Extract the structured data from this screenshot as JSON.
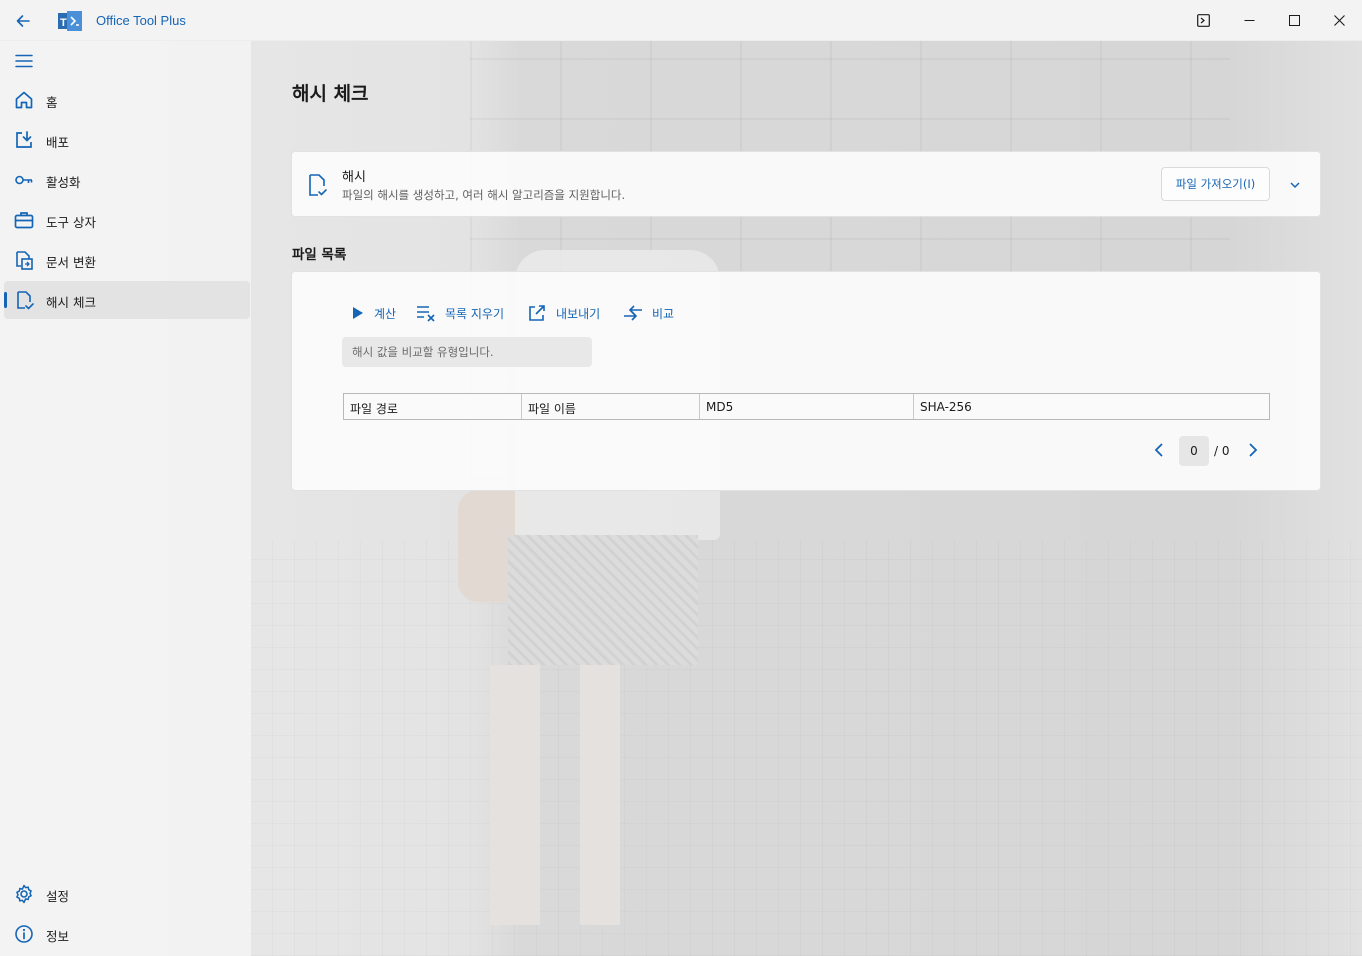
{
  "window": {
    "title": "Office Tool Plus",
    "logo_text": "T"
  },
  "sidebar": {
    "items": [
      {
        "label": "홈",
        "icon": "home-icon"
      },
      {
        "label": "배포",
        "icon": "deploy-icon"
      },
      {
        "label": "활성화",
        "icon": "key-icon"
      },
      {
        "label": "도구 상자",
        "icon": "toolbox-icon"
      },
      {
        "label": "문서 변환",
        "icon": "document-convert-icon"
      },
      {
        "label": "해시 체크",
        "icon": "hash-check-icon",
        "active": true
      }
    ],
    "footer": [
      {
        "label": "설정",
        "icon": "gear-icon"
      },
      {
        "label": "정보",
        "icon": "info-icon"
      }
    ]
  },
  "main": {
    "page_title": "해시 체크",
    "hash_card": {
      "title": "해시",
      "description": "파일의 해시를 생성하고, 여러 해시 알고리즘을 지원합니다.",
      "import_label": "파일 가져오기(I)"
    },
    "file_list": {
      "title": "파일 목록",
      "toolbar": {
        "calculate": "계산",
        "clear_list": "목록 지우기",
        "export": "내보내기",
        "compare": "비교"
      },
      "hash_input_placeholder": "해시 값을 비교할 유형입니다.",
      "columns": [
        "파일 경로",
        "파일 이름",
        "MD5",
        "SHA-256"
      ],
      "rows": [],
      "pager": {
        "current": "0",
        "total": "/ 0"
      }
    }
  },
  "colors": {
    "accent": "#1565b6",
    "sidebar_bg": "#f3f3f3",
    "card_bg": "#fbfbfb"
  }
}
